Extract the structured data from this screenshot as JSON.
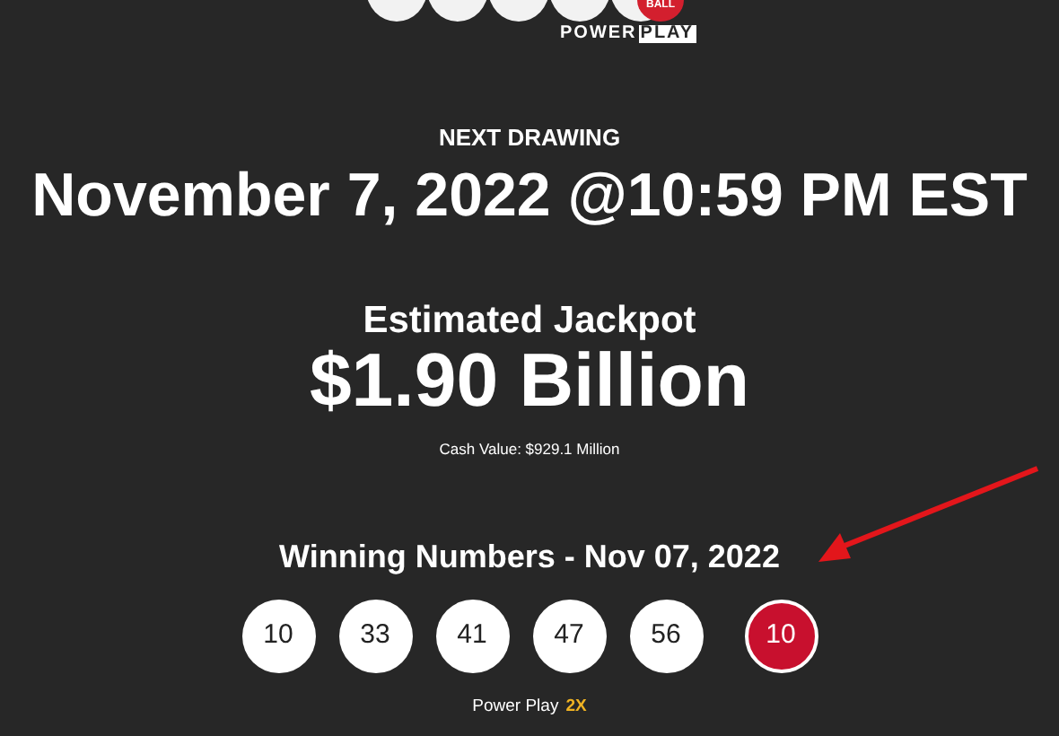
{
  "logo": {
    "ball_text": "BALL",
    "power_text": "POWER",
    "play_text": "PLAY"
  },
  "next_drawing": {
    "label": "NEXT DRAWING",
    "date": "November 7, 2022 @10:59 PM EST"
  },
  "jackpot": {
    "label": "Estimated Jackpot",
    "amount": "$1.90 Billion",
    "cash_value": "Cash Value: $929.1 Million"
  },
  "winning": {
    "heading": "Winning Numbers - Nov 07, 2022",
    "numbers": [
      {
        "value": "10",
        "kind": "white"
      },
      {
        "value": "33",
        "kind": "white"
      },
      {
        "value": "41",
        "kind": "white"
      },
      {
        "value": "47",
        "kind": "white"
      },
      {
        "value": "56",
        "kind": "white"
      },
      {
        "value": "10",
        "kind": "power"
      }
    ],
    "power_play": {
      "label": "Power Play",
      "multiplier": "2X"
    }
  },
  "annotation": {
    "kind": "arrow"
  }
}
